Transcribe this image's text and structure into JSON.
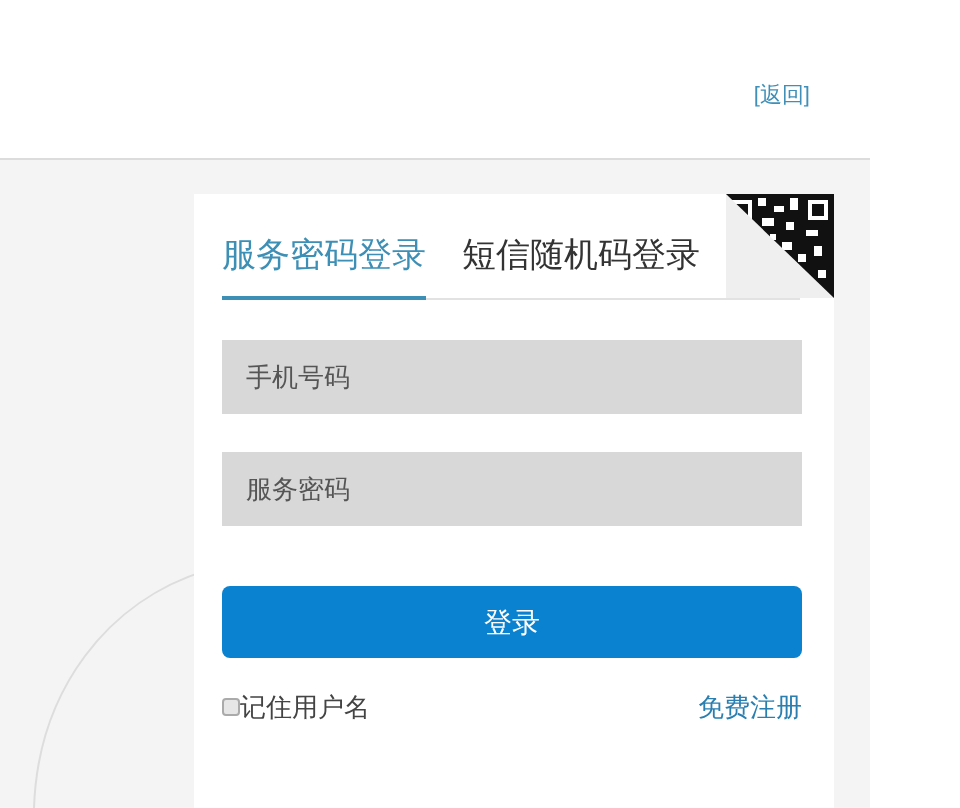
{
  "header": {
    "back_link": "[返回]"
  },
  "login": {
    "tabs": [
      {
        "label": "服务密码登录",
        "selected": true
      },
      {
        "label": "短信随机码登录",
        "selected": false
      }
    ],
    "fields": [
      {
        "placeholder": "手机号码"
      },
      {
        "placeholder": "服务密码"
      }
    ],
    "submit_button": "登录",
    "remember": {
      "label": "记住用户名",
      "checked": false
    },
    "register_link": "免费注册"
  }
}
